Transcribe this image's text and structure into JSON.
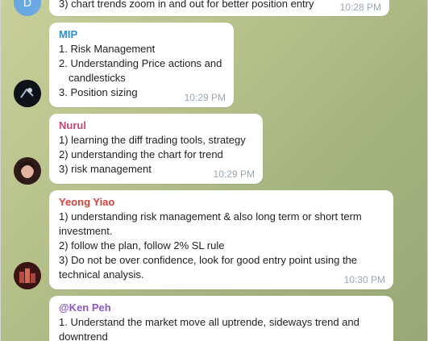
{
  "messages": [
    {
      "avatar_letter": "D",
      "lines": [
        "3) chart trends zoom in and out for better position entry"
      ],
      "time": "10:28 PM"
    },
    {
      "sender": "MIP",
      "sender_color": "#2f8fcf",
      "lines": [
        "1. Risk Management",
        "2. Understanding Price actions and",
        "candlesticks",
        "3. Position sizing"
      ],
      "time": "10:29 PM"
    },
    {
      "sender": "Nurul",
      "sender_color": "#c54a73",
      "lines": [
        "1) learning the diff trading tools, strategy",
        "2) understanding the chart for trend",
        "3) risk management"
      ],
      "time": "10:29 PM"
    },
    {
      "sender": "Yeong Yiao",
      "sender_color": "#d2433c",
      "lines": [
        "1) understanding risk management & also long term or short term",
        "investment.",
        "2) follow the plan, follow 2% SL rule",
        "3) Do not be over confidence, look for good entry point using the",
        "technical analysis."
      ],
      "time": "10:30 PM"
    },
    {
      "sender": "@Ken Peh",
      "sender_color": "#8a58c6",
      "lines": [
        "1. Understand the market move all uptrende, sideways trend and",
        "downtrend"
      ]
    }
  ]
}
